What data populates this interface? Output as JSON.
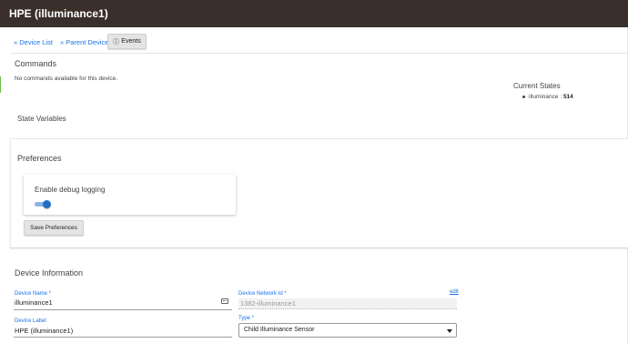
{
  "header": {
    "title": "HPE (illuminance1)"
  },
  "nav": {
    "device_list": "« Device List",
    "parent_device": "« Parent Device",
    "events": "Events",
    "events_icon": "info-circle-icon"
  },
  "commands": {
    "heading": "Commands",
    "empty_text": "No commands available for this device."
  },
  "current_states": {
    "heading": "Current States",
    "items": [
      {
        "name": "illuminance : ",
        "value": "514"
      }
    ]
  },
  "state_variables": {
    "heading": "State Variables"
  },
  "preferences": {
    "heading": "Preferences",
    "debug_label": "Enable debug logging",
    "debug_enabled": true,
    "save_label": "Save Preferences"
  },
  "device_info": {
    "heading": "Device Information",
    "device_name_label": "Device Name *",
    "device_name_value": "illuminance1",
    "network_id_label": "Device Network Id *",
    "network_id_value": "1382-illuminance1",
    "network_id_edit": "edit",
    "device_label_label": "Device Label",
    "device_label_value": "HPE (illuminance1)",
    "type_label": "Type *",
    "type_value": "Child Illuminance Sensor"
  },
  "colors": {
    "header_bg": "#3b2f2b",
    "link": "#1a73e8",
    "toggle_on": "#1f6fc9",
    "accent_green": "#6bbd45"
  }
}
